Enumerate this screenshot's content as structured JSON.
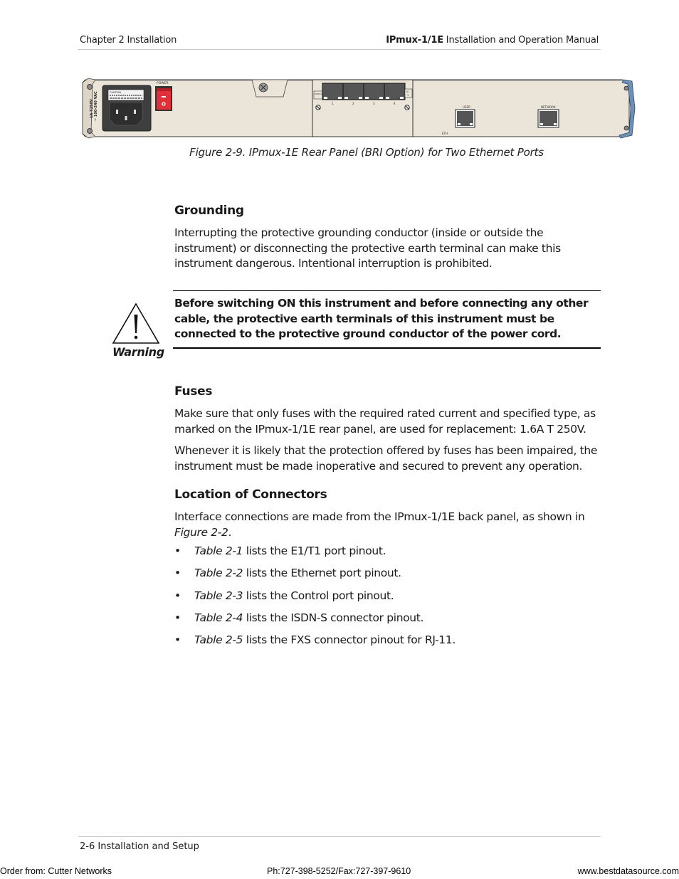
{
  "header": {
    "left": "Chapter 2  Installation",
    "right_bold": "IPmux-1/1E",
    "right_rest": " Installation and Operation Manual"
  },
  "figure": {
    "caption": "Figure 2-9.  IPmux-1E Rear Panel (BRI Option) for Two Ethernet Ports",
    "labels": {
      "power": "POWER",
      "fuse_rating": "1A T250V",
      "voltage": "~ 100-240 VAC",
      "caution": "CAUTION",
      "isdn": "ISDN S",
      "io": "IO",
      "io_num": "3",
      "port_numbers": [
        "1",
        "2",
        "3",
        "4"
      ],
      "user": "USER",
      "network": "NETWORK",
      "eth": "ETH"
    }
  },
  "grounding": {
    "heading": "Grounding",
    "body": "Interrupting the protective grounding conductor (inside or outside the instrument) or disconnecting the protective earth terminal can make this instrument dangerous. Intentional interruption is prohibited."
  },
  "warning": {
    "label": "Warning",
    "text": "Before switching ON this instrument and before connecting any other cable, the protective earth terminals of this instrument must be connected to the protective ground conductor of the power cord."
  },
  "fuses": {
    "heading": "Fuses",
    "para1": "Make sure that only fuses with the required rated current and specified type, as marked on the IPmux-1/1E rear panel, are used for replacement: 1.6A T 250V.",
    "para2": "Whenever it is likely that the protection offered by fuses has been impaired, the instrument must be made inoperative and secured to prevent any operation."
  },
  "connectors": {
    "heading": "Location of Connectors",
    "intro": "Interface connections  are made from the IPmux-1/1E back panel, as shown in ",
    "intro_ref": "Figure 2-2",
    "intro_end": ".",
    "items": [
      {
        "ref": "Table 2-1",
        "text": " lists the E1/T1 port pinout."
      },
      {
        "ref": "Table 2-2",
        "text": " lists the Ethernet port pinout."
      },
      {
        "ref": "Table 2-3",
        "text": " lists the Control port pinout."
      },
      {
        "ref": "Table 2-4",
        "text": " lists the ISDN-S connector pinout."
      },
      {
        "ref": "Table 2-5",
        "text": " lists the FXS connector pinout for RJ-11."
      }
    ]
  },
  "footer": {
    "page": "2-6   Installation and Setup",
    "order_from": "Order from: Cutter Networks",
    "phone": "Ph:727-398-5252/Fax:727-397-9610",
    "website": "www.bestdatasource.com"
  },
  "colors": {
    "panel": "#ebe5d9",
    "switch_red": "#e0313a",
    "handle_blue": "#6f8fb5",
    "port_dark": "#555555"
  }
}
